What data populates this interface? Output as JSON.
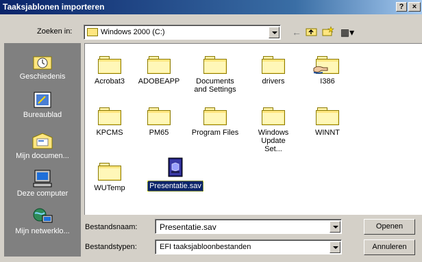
{
  "window": {
    "title": "Taaksjablonen importeren",
    "help_glyph": "?",
    "close_glyph": "×"
  },
  "lookin": {
    "label": "Zoeken in:",
    "value": "Windows 2000 (C:)",
    "icon": "drive-folder-icon"
  },
  "toolbar": {
    "back_icon": "←",
    "up_icon": "⬆",
    "newfolder_icon": "✳",
    "view_icon": "▦▾"
  },
  "places": [
    {
      "label": "Geschiedenis",
      "icon": "history-icon"
    },
    {
      "label": "Bureaublad",
      "icon": "desktop-icon"
    },
    {
      "label": "Mijn documen...",
      "icon": "my-documents-icon"
    },
    {
      "label": "Deze computer",
      "icon": "my-computer-icon"
    },
    {
      "label": "Mijn netwerklo...",
      "icon": "network-places-icon"
    }
  ],
  "files": [
    {
      "name": "Acrobat3",
      "type": "folder"
    },
    {
      "name": "ADOBEAPP",
      "type": "folder"
    },
    {
      "name": "Documents and Settings",
      "type": "folder"
    },
    {
      "name": "drivers",
      "type": "folder"
    },
    {
      "name": "I386",
      "type": "shared-folder"
    },
    {
      "name": "KPCMS",
      "type": "folder"
    },
    {
      "name": "PM65",
      "type": "folder"
    },
    {
      "name": "Program Files",
      "type": "folder"
    },
    {
      "name": "Windows Update Set...",
      "type": "folder"
    },
    {
      "name": "WINNT",
      "type": "folder"
    },
    {
      "name": "WUTemp",
      "type": "folder"
    },
    {
      "name": "Presentatie.sav",
      "type": "file",
      "selected": true
    }
  ],
  "filename": {
    "label": "Bestandsnaam:",
    "value": "Presentatie.sav"
  },
  "filetype": {
    "label": "Bestandstypen:",
    "value": "EFI taaksjabloonbestanden"
  },
  "buttons": {
    "open": "Openen",
    "cancel": "Annuleren"
  },
  "colors": {
    "title_bar": "#0a246a",
    "selection": "#0a246a",
    "places_bg": "#808080",
    "folder": "#ffe680"
  }
}
